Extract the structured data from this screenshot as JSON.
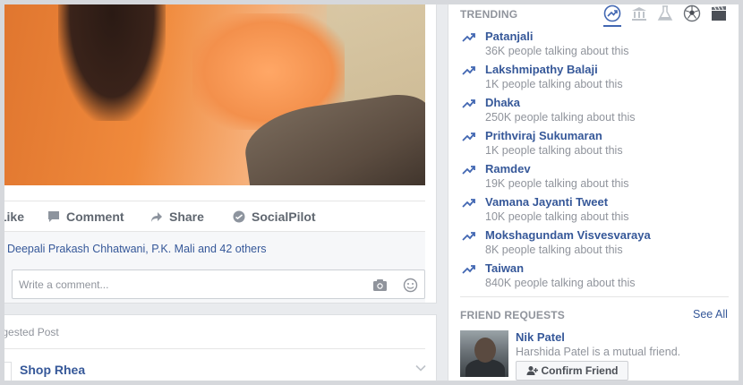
{
  "post": {
    "actions": {
      "like_label": "Like",
      "comment_label": "Comment",
      "share_label": "Share",
      "socialpilot_label": "SocialPilot"
    },
    "likers_text": "Deepali Prakash Chhatwani, P.K. Mali and 42 others",
    "comment_placeholder": "Write a comment..."
  },
  "suggested": {
    "label": "Suggested Post",
    "page_name": "Shop Rhea"
  },
  "trending": {
    "title": "TRENDING",
    "tabs": [
      "trending-icon",
      "politics-icon",
      "science-icon",
      "sports-icon",
      "entertainment-icon"
    ],
    "items": [
      {
        "name": "Patanjali",
        "count": "36K people talking about this"
      },
      {
        "name": "Lakshmipathy Balaji",
        "count": "1K people talking about this"
      },
      {
        "name": "Dhaka",
        "count": "250K people talking about this"
      },
      {
        "name": "Prithviraj Sukumaran",
        "count": "1K people talking about this"
      },
      {
        "name": "Ramdev",
        "count": "19K people talking about this"
      },
      {
        "name": "Vamana Jayanti Tweet",
        "count": "10K people talking about this"
      },
      {
        "name": "Mokshagundam Visvesvaraya",
        "count": "8K people talking about this"
      },
      {
        "name": "Taiwan",
        "count": "840K people talking about this"
      }
    ]
  },
  "friend_requests": {
    "title": "FRIEND REQUESTS",
    "see_all": "See All",
    "request": {
      "name": "Nik Patel",
      "mutual": "Harshida Patel is a mutual friend.",
      "confirm_label": "Confirm Friend"
    }
  },
  "colors": {
    "link_blue": "#365899",
    "accent_blue": "#4267b2",
    "muted_gray": "#90949c",
    "background": "#e9ebee"
  }
}
